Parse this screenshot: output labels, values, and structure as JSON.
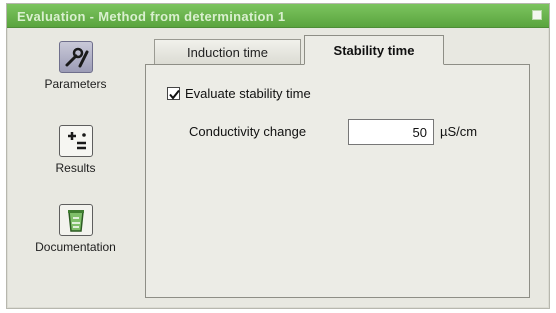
{
  "window": {
    "title": "Evaluation - Method from determination 1"
  },
  "sidebar": {
    "items": [
      {
        "label": "Parameters",
        "icon": "wrench-pencil-icon"
      },
      {
        "label": "Results",
        "icon": "plus-equals-icon"
      },
      {
        "label": "Documentation",
        "icon": "recycle-bin-icon"
      }
    ]
  },
  "tabs": [
    {
      "label": "Induction time",
      "active": false
    },
    {
      "label": "Stability time",
      "active": true
    }
  ],
  "stability": {
    "evaluate_label": "Evaluate stability time",
    "evaluate_checked": true,
    "conductivity_label": "Conductivity change",
    "conductivity_value": "50",
    "conductivity_unit": "µS/cm"
  },
  "colors": {
    "titlebar": "#64ae47",
    "window_bg": "#e8e8e1"
  }
}
